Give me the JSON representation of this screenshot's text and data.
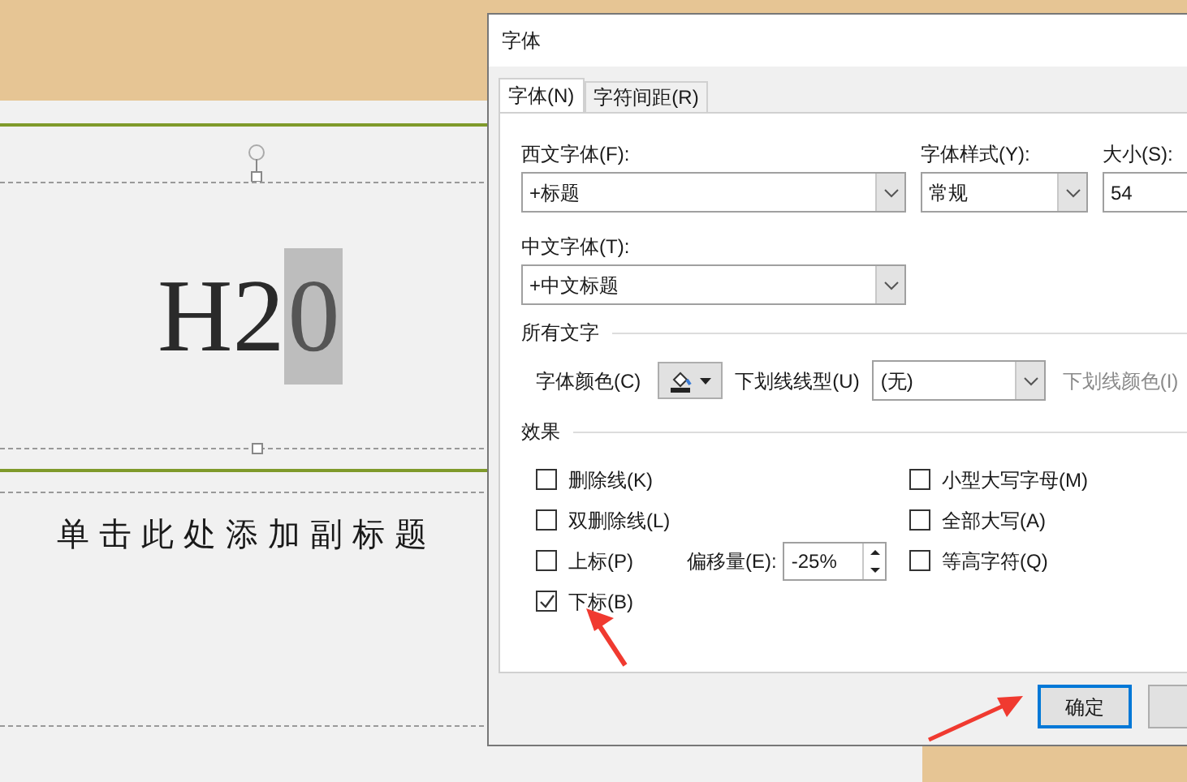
{
  "slide": {
    "title_parts": [
      {
        "text": "H2",
        "selected": false
      },
      {
        "text": "0",
        "selected": true
      }
    ],
    "subtitle": "单击此处添加副标题"
  },
  "dialog": {
    "title": "字体",
    "tabs": [
      {
        "label": "字体(N)",
        "selected": true
      },
      {
        "label": "字符间距(R)",
        "selected": false
      }
    ],
    "latin_font": {
      "label": "西文字体(F):",
      "value": "+标题"
    },
    "font_style": {
      "label": "字体样式(Y):",
      "value": "常规"
    },
    "size": {
      "label": "大小(S):",
      "value": "54"
    },
    "asian_font": {
      "label": "中文字体(T):",
      "value": "+中文标题"
    },
    "all_text": {
      "heading": "所有文字",
      "font_color_label": "字体颜色(C)",
      "underline_style_label": "下划线线型(U)",
      "underline_style_value": "(无)",
      "underline_color_label": "下划线颜色(I)",
      "underline_color_disabled": true
    },
    "effects": {
      "heading": "效果",
      "left": [
        {
          "label": "删除线(K)",
          "checked": false
        },
        {
          "label": "双删除线(L)",
          "checked": false
        },
        {
          "label": "上标(P)",
          "checked": false
        },
        {
          "label": "下标(B)",
          "checked": true
        }
      ],
      "right": [
        {
          "label": "小型大写字母(M)",
          "checked": false
        },
        {
          "label": "全部大写(A)",
          "checked": false
        },
        {
          "label": "等高字符(Q)",
          "checked": false
        }
      ],
      "offset_label": "偏移量(E):",
      "offset_value": "-25%"
    },
    "buttons": [
      {
        "label": "确定",
        "focused": true
      }
    ]
  }
}
